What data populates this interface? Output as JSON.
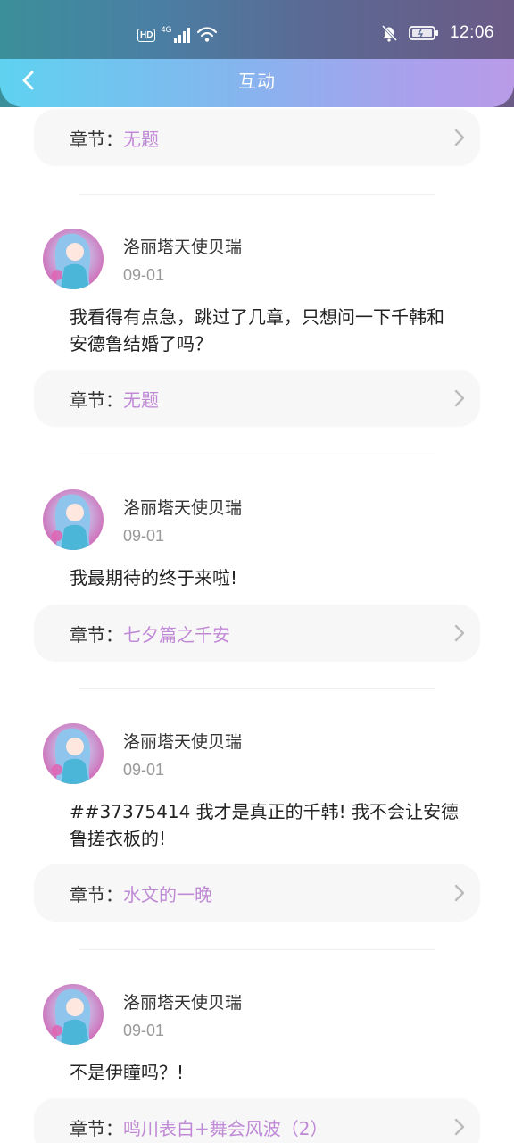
{
  "status_bar": {
    "hd_label": "HD",
    "network_label": "4G",
    "time": "12:06"
  },
  "nav": {
    "title": "互动"
  },
  "chapter_prefix": "章节：",
  "first_chapter": {
    "title": "无题"
  },
  "comments": [
    {
      "username": "洛丽塔天使贝瑞",
      "date": "09-01",
      "text_line1": "我看得有点急，跳过了几章，只想问一下千韩和",
      "text_line2": "安德鲁结婚了吗？",
      "chapter": "无题"
    },
    {
      "username": "洛丽塔天使贝瑞",
      "date": "09-01",
      "text_line1": "我最期待的终于来啦!",
      "text_line2": "",
      "chapter": "七夕篇之千安"
    },
    {
      "username": "洛丽塔天使贝瑞",
      "date": "09-01",
      "text_line1": "##37375414 我才是真正的千韩! 我不会让安德",
      "text_line2": "鲁搓衣板的!",
      "chapter": "水文的一晚"
    },
    {
      "username": "洛丽塔天使贝瑞",
      "date": "09-01",
      "text_line1": "不是伊瞳吗？!",
      "text_line2": "",
      "chapter": "鸣川表白+舞会风波（2）"
    }
  ],
  "colors": {
    "accent": "#c089d6",
    "header_gradient_start": "#5fd2f0",
    "header_gradient_end": "#b99be8"
  },
  "icons": {
    "back": "chevron-left-icon",
    "row_arrow": "chevron-right-icon",
    "signal": "signal-icon",
    "wifi": "wifi-icon",
    "mute": "bell-off-icon",
    "battery": "battery-icon"
  }
}
